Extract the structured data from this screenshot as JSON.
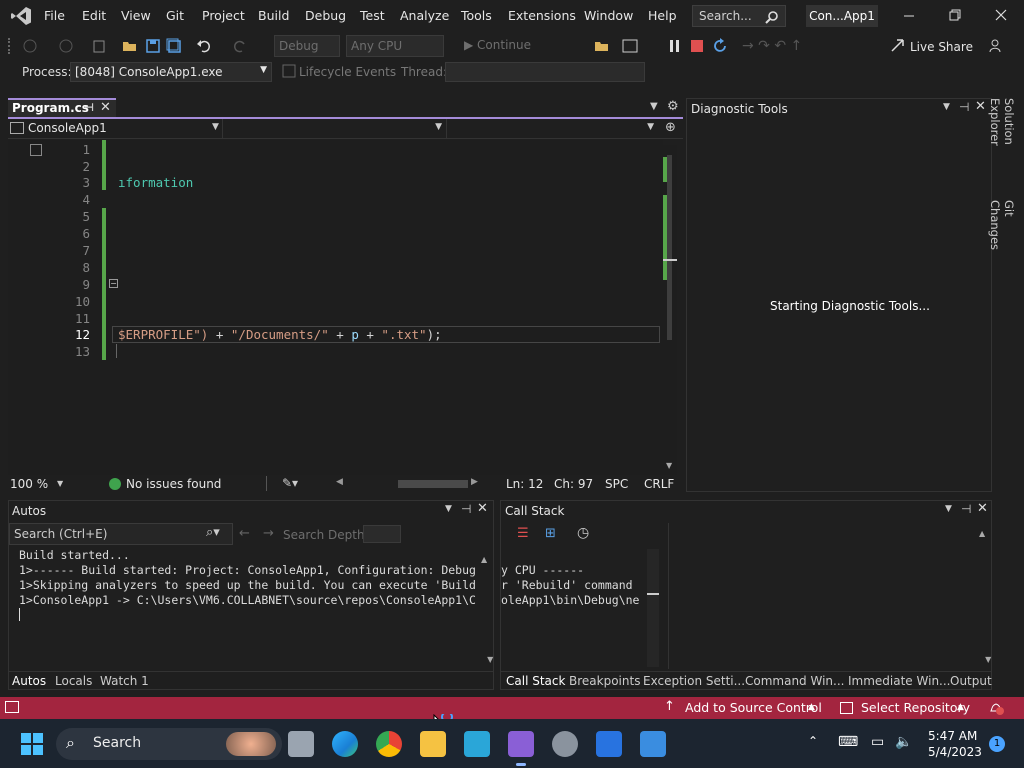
{
  "menu": [
    "File",
    "Edit",
    "View",
    "Git",
    "Project",
    "Build",
    "Debug",
    "Test",
    "Analyze",
    "Tools",
    "Extensions",
    "Window",
    "Help"
  ],
  "search_placeholder": "Search...",
  "solution_title": "Con...App1",
  "toolbar": {
    "config": "Debug",
    "platform": "Any CPU",
    "continue_label": "Continue",
    "live_share": "Live Share"
  },
  "process": {
    "label": "Process:",
    "value": "[8048] ConsoleApp1.exe",
    "lifecycle": "Lifecycle Events",
    "thread_label": "Thread:"
  },
  "editor": {
    "tab_title": "Program.cs",
    "project": "ConsoleApp1",
    "lines": [
      "1",
      "2",
      "3",
      "4",
      "5",
      "6",
      "7",
      "8",
      "9",
      "10",
      "11",
      "12",
      "13"
    ],
    "line3_text": "ıformation",
    "line12_a": "$ERPROFILE\")",
    "line12_b": " + ",
    "line12_c": "\"/Documents/\"",
    "line12_d": " + ",
    "line12_e": "p",
    "line12_f": " + ",
    "line12_g": "\".txt\"",
    "line12_h": ");",
    "zoom": "100 %",
    "issues": "No issues found",
    "ln": "Ln: 12",
    "ch": "Ch: 97",
    "spc": "SPC",
    "crlf": "CRLF"
  },
  "diagnostic": {
    "title": "Diagnostic Tools",
    "message": "Starting Diagnostic Tools..."
  },
  "side_tabs": [
    "Solution Explorer",
    "Git Changes"
  ],
  "autos": {
    "title": "Autos",
    "search_placeholder": "Search (Ctrl+E)",
    "search_depth": "Search Depth:",
    "output": [
      "Build started...",
      "1>------ Build started: Project: ConsoleApp1, Configuration: Debug",
      "1>Skipping analyzers to speed up the build. You can execute 'Build",
      "1>ConsoleApp1 -> C:\\Users\\VM6.COLLABNET\\source\\repos\\ConsoleApp1\\C"
    ],
    "tabs": [
      "Autos",
      "Locals",
      "Watch 1"
    ]
  },
  "callstack": {
    "title": "Call Stack",
    "output": [
      "y CPU ------",
      "r 'Rebuild' command ",
      "oleApp1\\bin\\Debug\\ne"
    ],
    "tabs": [
      "Call Stack",
      "Breakpoints",
      "Exception Setti...",
      "Command Win...",
      "Immediate Win...",
      "Output"
    ]
  },
  "statusbar": {
    "source_control": "Add to Source Control",
    "repository": "Select Repository"
  },
  "taskbar": {
    "search": "Search",
    "time": "5:47 AM",
    "date": "5/4/2023",
    "badge": "1"
  },
  "colors": {
    "accent": "#a48bd9",
    "statusbar": "#a3253f",
    "string": "#d69d85",
    "keyword_green": "#4ec9b0"
  }
}
